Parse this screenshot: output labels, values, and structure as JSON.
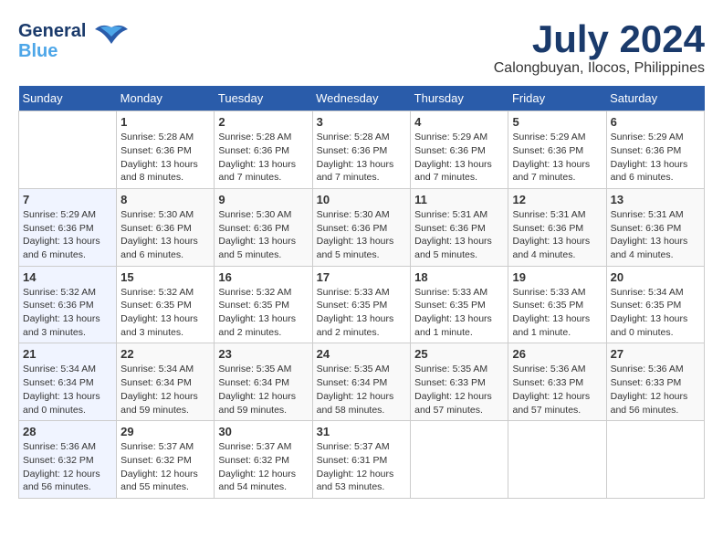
{
  "header": {
    "logo_line1": "General",
    "logo_line2": "Blue",
    "title": "July 2024",
    "location": "Calongbuyan, Ilocos, Philippines"
  },
  "calendar": {
    "days_of_week": [
      "Sunday",
      "Monday",
      "Tuesday",
      "Wednesday",
      "Thursday",
      "Friday",
      "Saturday"
    ],
    "weeks": [
      [
        {
          "day": "",
          "sunrise": "",
          "sunset": "",
          "daylight": ""
        },
        {
          "day": "1",
          "sunrise": "Sunrise: 5:28 AM",
          "sunset": "Sunset: 6:36 PM",
          "daylight": "Daylight: 13 hours and 8 minutes."
        },
        {
          "day": "2",
          "sunrise": "Sunrise: 5:28 AM",
          "sunset": "Sunset: 6:36 PM",
          "daylight": "Daylight: 13 hours and 7 minutes."
        },
        {
          "day": "3",
          "sunrise": "Sunrise: 5:28 AM",
          "sunset": "Sunset: 6:36 PM",
          "daylight": "Daylight: 13 hours and 7 minutes."
        },
        {
          "day": "4",
          "sunrise": "Sunrise: 5:29 AM",
          "sunset": "Sunset: 6:36 PM",
          "daylight": "Daylight: 13 hours and 7 minutes."
        },
        {
          "day": "5",
          "sunrise": "Sunrise: 5:29 AM",
          "sunset": "Sunset: 6:36 PM",
          "daylight": "Daylight: 13 hours and 7 minutes."
        },
        {
          "day": "6",
          "sunrise": "Sunrise: 5:29 AM",
          "sunset": "Sunset: 6:36 PM",
          "daylight": "Daylight: 13 hours and 6 minutes."
        }
      ],
      [
        {
          "day": "7",
          "sunrise": "Sunrise: 5:29 AM",
          "sunset": "Sunset: 6:36 PM",
          "daylight": "Daylight: 13 hours and 6 minutes."
        },
        {
          "day": "8",
          "sunrise": "Sunrise: 5:30 AM",
          "sunset": "Sunset: 6:36 PM",
          "daylight": "Daylight: 13 hours and 6 minutes."
        },
        {
          "day": "9",
          "sunrise": "Sunrise: 5:30 AM",
          "sunset": "Sunset: 6:36 PM",
          "daylight": "Daylight: 13 hours and 5 minutes."
        },
        {
          "day": "10",
          "sunrise": "Sunrise: 5:30 AM",
          "sunset": "Sunset: 6:36 PM",
          "daylight": "Daylight: 13 hours and 5 minutes."
        },
        {
          "day": "11",
          "sunrise": "Sunrise: 5:31 AM",
          "sunset": "Sunset: 6:36 PM",
          "daylight": "Daylight: 13 hours and 5 minutes."
        },
        {
          "day": "12",
          "sunrise": "Sunrise: 5:31 AM",
          "sunset": "Sunset: 6:36 PM",
          "daylight": "Daylight: 13 hours and 4 minutes."
        },
        {
          "day": "13",
          "sunrise": "Sunrise: 5:31 AM",
          "sunset": "Sunset: 6:36 PM",
          "daylight": "Daylight: 13 hours and 4 minutes."
        }
      ],
      [
        {
          "day": "14",
          "sunrise": "Sunrise: 5:32 AM",
          "sunset": "Sunset: 6:36 PM",
          "daylight": "Daylight: 13 hours and 3 minutes."
        },
        {
          "day": "15",
          "sunrise": "Sunrise: 5:32 AM",
          "sunset": "Sunset: 6:35 PM",
          "daylight": "Daylight: 13 hours and 3 minutes."
        },
        {
          "day": "16",
          "sunrise": "Sunrise: 5:32 AM",
          "sunset": "Sunset: 6:35 PM",
          "daylight": "Daylight: 13 hours and 2 minutes."
        },
        {
          "day": "17",
          "sunrise": "Sunrise: 5:33 AM",
          "sunset": "Sunset: 6:35 PM",
          "daylight": "Daylight: 13 hours and 2 minutes."
        },
        {
          "day": "18",
          "sunrise": "Sunrise: 5:33 AM",
          "sunset": "Sunset: 6:35 PM",
          "daylight": "Daylight: 13 hours and 1 minute."
        },
        {
          "day": "19",
          "sunrise": "Sunrise: 5:33 AM",
          "sunset": "Sunset: 6:35 PM",
          "daylight": "Daylight: 13 hours and 1 minute."
        },
        {
          "day": "20",
          "sunrise": "Sunrise: 5:34 AM",
          "sunset": "Sunset: 6:35 PM",
          "daylight": "Daylight: 13 hours and 0 minutes."
        }
      ],
      [
        {
          "day": "21",
          "sunrise": "Sunrise: 5:34 AM",
          "sunset": "Sunset: 6:34 PM",
          "daylight": "Daylight: 13 hours and 0 minutes."
        },
        {
          "day": "22",
          "sunrise": "Sunrise: 5:34 AM",
          "sunset": "Sunset: 6:34 PM",
          "daylight": "Daylight: 12 hours and 59 minutes."
        },
        {
          "day": "23",
          "sunrise": "Sunrise: 5:35 AM",
          "sunset": "Sunset: 6:34 PM",
          "daylight": "Daylight: 12 hours and 59 minutes."
        },
        {
          "day": "24",
          "sunrise": "Sunrise: 5:35 AM",
          "sunset": "Sunset: 6:34 PM",
          "daylight": "Daylight: 12 hours and 58 minutes."
        },
        {
          "day": "25",
          "sunrise": "Sunrise: 5:35 AM",
          "sunset": "Sunset: 6:33 PM",
          "daylight": "Daylight: 12 hours and 57 minutes."
        },
        {
          "day": "26",
          "sunrise": "Sunrise: 5:36 AM",
          "sunset": "Sunset: 6:33 PM",
          "daylight": "Daylight: 12 hours and 57 minutes."
        },
        {
          "day": "27",
          "sunrise": "Sunrise: 5:36 AM",
          "sunset": "Sunset: 6:33 PM",
          "daylight": "Daylight: 12 hours and 56 minutes."
        }
      ],
      [
        {
          "day": "28",
          "sunrise": "Sunrise: 5:36 AM",
          "sunset": "Sunset: 6:32 PM",
          "daylight": "Daylight: 12 hours and 56 minutes."
        },
        {
          "day": "29",
          "sunrise": "Sunrise: 5:37 AM",
          "sunset": "Sunset: 6:32 PM",
          "daylight": "Daylight: 12 hours and 55 minutes."
        },
        {
          "day": "30",
          "sunrise": "Sunrise: 5:37 AM",
          "sunset": "Sunset: 6:32 PM",
          "daylight": "Daylight: 12 hours and 54 minutes."
        },
        {
          "day": "31",
          "sunrise": "Sunrise: 5:37 AM",
          "sunset": "Sunset: 6:31 PM",
          "daylight": "Daylight: 12 hours and 53 minutes."
        },
        {
          "day": "",
          "sunrise": "",
          "sunset": "",
          "daylight": ""
        },
        {
          "day": "",
          "sunrise": "",
          "sunset": "",
          "daylight": ""
        },
        {
          "day": "",
          "sunrise": "",
          "sunset": "",
          "daylight": ""
        }
      ]
    ]
  }
}
